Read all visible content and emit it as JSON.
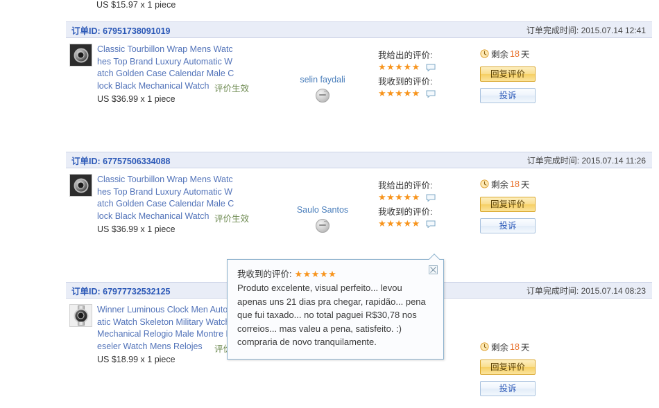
{
  "meta": {
    "colors": {
      "header_bar_bg": "#e9edf7",
      "order_id_blue": "#2b58b7",
      "product_link_blue": "#5273b9",
      "status_green": "#6f8b52",
      "star_orange": "#f7941d",
      "remain_orange": "#e8702a",
      "reply_button_gold": "#f6cf63",
      "tooltip_border": "#8ab0cc"
    }
  },
  "top_partial_row": {
    "price_text": "US $15.97 x 1 piece"
  },
  "labels": {
    "order_id_prefix": "订单ID:",
    "order_time_prefix": "订单完成时间:",
    "rating_given": "我给出的评价:",
    "rating_received": "我收到的评价:",
    "remain_prefix": "剩余",
    "remain_suffix": "天",
    "reply_button": "回复评价",
    "complain_button": "投诉",
    "status_effective": "评价生效",
    "stars_five": "★★★★★"
  },
  "orders": [
    {
      "id": "67951738091019",
      "completed_at": "2015.07.14 12:41",
      "thumb": "watch-dark-thumb",
      "product_title": "Classic Tourbillon Wrap Mens Watches Top Brand Luxury Automatic Watch Golden Case Calendar Male Clock Black Mechanical Watch",
      "product_price": "US $36.99 x 1 piece",
      "status": "评价生效",
      "buyer": "selin faydali",
      "rating_given_stars": "★★★★★",
      "rating_received_stars": "★★★★★",
      "remain_days": "18"
    },
    {
      "id": "67757506334088",
      "completed_at": "2015.07.14 11:26",
      "thumb": "watch-dark-thumb",
      "product_title": "Classic Tourbillon Wrap Mens Watches Top Brand Luxury Automatic Watch Golden Case Calendar Male Clock Black Mechanical Watch",
      "product_price": "US $36.99 x 1 piece",
      "status": "评价生效",
      "buyer": "Saulo Santos",
      "rating_given_stars": "★★★★★",
      "rating_received_stars": "★★★★★",
      "remain_days": "18"
    },
    {
      "id": "67977732532125",
      "completed_at": "2015.07.14 08:23",
      "thumb": "watch-steel-thumb",
      "product_title": "Winner Luminous Clock Men Automatic Watch Skeleton Military Watch Mechanical Relogio Male Montre Dieseler Watch Mens Relojes",
      "product_price": "US $18.99 x 1 piece",
      "status": "评价生效",
      "buyer": "",
      "rating_given_stars": "",
      "rating_received_stars": "",
      "remain_days": "18"
    }
  ],
  "tooltip": {
    "title": "我收到的评价:",
    "stars": "★★★★★",
    "text": "Produto excelente, visual perfeito... levou apenas uns 21 dias pra chegar, rapidão... pena que fui taxado... no total paguei R$30,78 nos correios... mas valeu a pena, satisfeito. :) compraria de novo tranquilamente."
  }
}
